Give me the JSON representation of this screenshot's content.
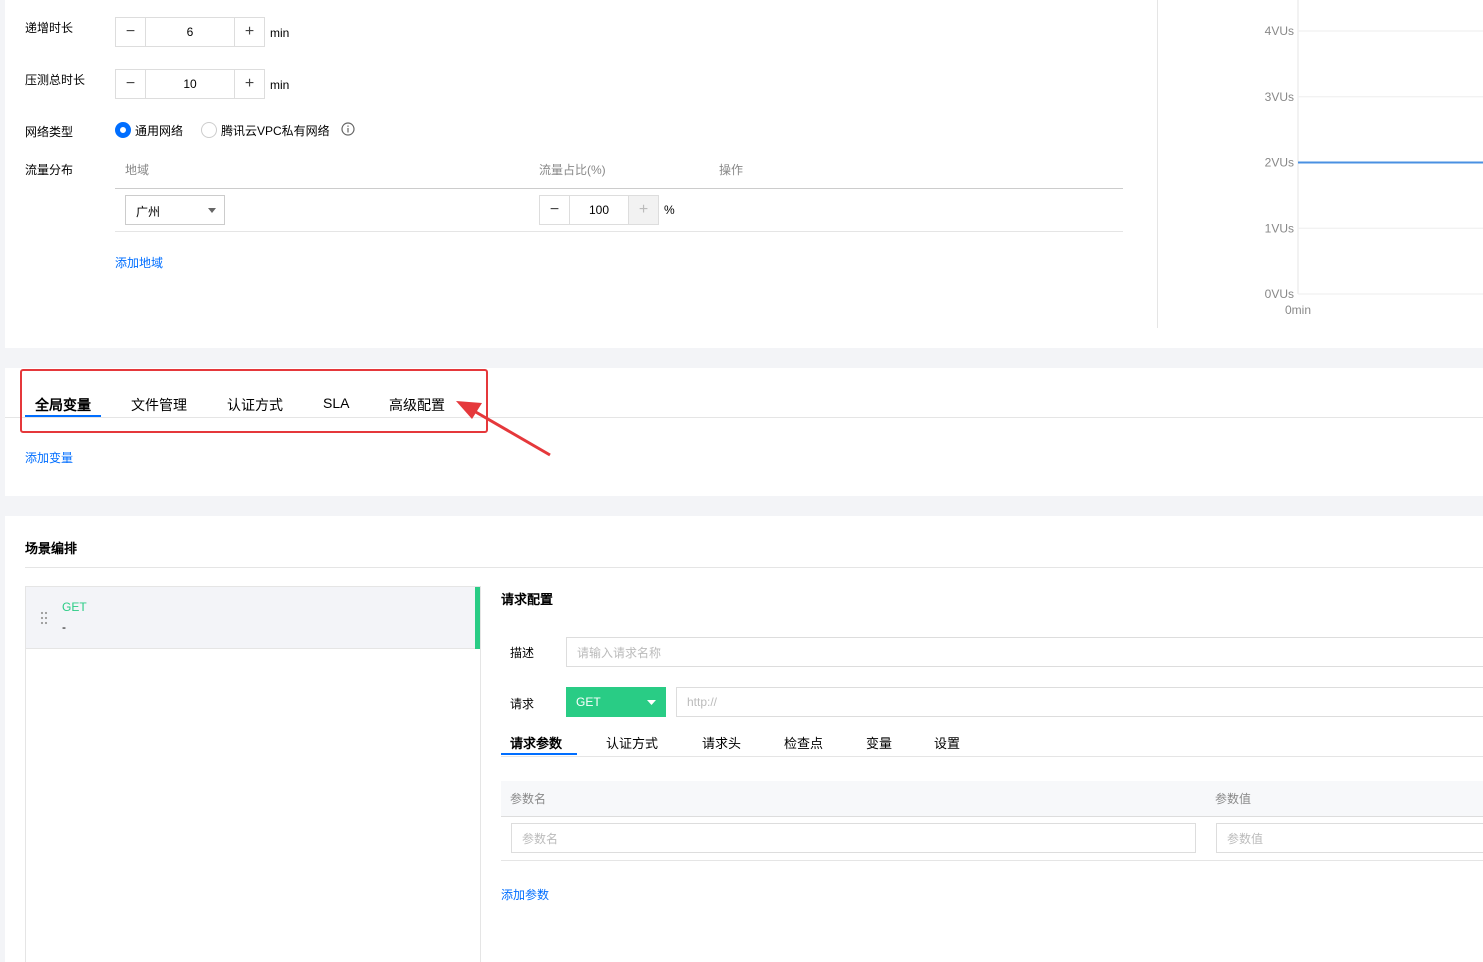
{
  "load_config": {
    "ramp_label": "递增时长",
    "ramp_value": "6",
    "ramp_unit": "min",
    "duration_label": "压测总时长",
    "duration_value": "10",
    "duration_unit": "min",
    "network_label": "网络类型",
    "network_options": [
      "通用网络",
      "腾讯云VPC私有网络"
    ],
    "traffic_label": "流量分布",
    "traffic_columns": [
      "地域",
      "流量占比(%)",
      "操作"
    ],
    "region_value": "广州",
    "ratio_value": "100",
    "ratio_unit": "%",
    "add_region": "添加地域"
  },
  "chart_data": {
    "type": "line",
    "y_ticks": [
      "4VUs",
      "3VUs",
      "2VUs",
      "1VUs",
      "0VUs"
    ],
    "x_ticks": [
      "0min"
    ],
    "ylim": [
      0,
      4
    ],
    "series": [
      {
        "values": [
          2,
          2
        ]
      }
    ],
    "line_color": "#4a90e2"
  },
  "config_tabs": {
    "tabs": [
      "全局变量",
      "文件管理",
      "认证方式",
      "SLA",
      "高级配置"
    ],
    "active": 0,
    "add_variable": "添加变量",
    "highlight_color": "#e5383b"
  },
  "scenario": {
    "title": "场景编排",
    "request_method": "GET",
    "request_name": "-",
    "method_color": "#29cc85"
  },
  "request_config": {
    "title": "请求配置",
    "desc_label": "描述",
    "desc_placeholder": "请输入请求名称",
    "req_label": "请求",
    "method": "GET",
    "url_placeholder": "http://",
    "tabs": [
      "请求参数",
      "认证方式",
      "请求头",
      "检查点",
      "变量",
      "设置"
    ],
    "active_tab": 0,
    "param_name_header": "参数名",
    "param_value_header": "参数值",
    "param_name_placeholder": "参数名",
    "param_value_placeholder": "参数值",
    "add_param": "添加参数"
  }
}
